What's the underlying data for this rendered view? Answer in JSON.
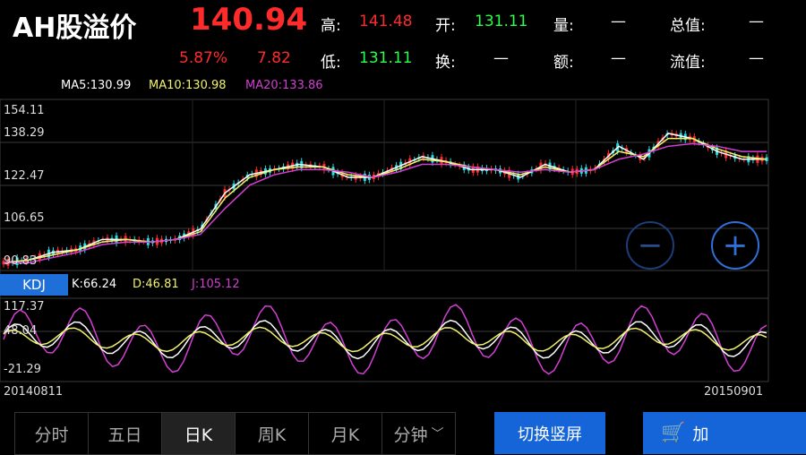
{
  "header": {
    "title": "AH股溢价",
    "price": "140.94",
    "change_pct": "5.87%",
    "change": "7.82",
    "fields": [
      {
        "label": "高:",
        "value": "141.48",
        "color": "#ff2b2b"
      },
      {
        "label": "开:",
        "value": "131.11",
        "color": "#2bff4a"
      },
      {
        "label": "量:",
        "value": "—",
        "color": "#ffffff"
      },
      {
        "label": "总值:",
        "value": "—",
        "color": "#ffffff"
      },
      {
        "label": "低:",
        "value": "131.11",
        "color": "#2bff4a"
      },
      {
        "label": "换:",
        "value": "—",
        "color": "#ffffff"
      },
      {
        "label": "额:",
        "value": "—",
        "color": "#ffffff"
      },
      {
        "label": "流值:",
        "value": "—",
        "color": "#ffffff"
      }
    ]
  },
  "ma": {
    "ma5": "MA5:130.99",
    "ma10": "MA10:130.98",
    "ma20": "MA20:133.86"
  },
  "price_axis": [
    "154.11",
    "138.29",
    "122.47",
    "106.65",
    "90.83"
  ],
  "kdj": {
    "tab": "KDJ",
    "k": "K:66.24",
    "d": "D:46.81",
    "j": "J:105.12",
    "axis": [
      "117.37",
      "48.04",
      "-21.29"
    ]
  },
  "dates": {
    "start": "20140811",
    "end": "20150901"
  },
  "periods": [
    "分时",
    "五日",
    "日K",
    "周K",
    "月K",
    "分钟"
  ],
  "selected_period": "日K",
  "buttons": {
    "rotate": "切换竖屏",
    "add": "加"
  },
  "colors": {
    "up": "#ff2b2b",
    "down": "#2bd9e0",
    "ma5": "#ffffff",
    "ma10": "#f2f26a",
    "ma20": "#d23fd2",
    "accent": "#1565d8"
  },
  "chart_data": {
    "type": "line",
    "series": [
      {
        "name": "MA5",
        "values": [
          91,
          92,
          95,
          96,
          100,
          100,
          99,
          100,
          104,
          118,
          125,
          127,
          129,
          128,
          124,
          124,
          128,
          132,
          130,
          127,
          127,
          124,
          129,
          126,
          127,
          136,
          131,
          141,
          139,
          134,
          131,
          131
        ]
      },
      {
        "name": "MA10",
        "values": [
          91,
          92,
          94,
          96,
          99,
          100,
          99,
          100,
          103,
          116,
          124,
          127,
          128,
          128,
          125,
          124,
          127,
          131,
          130,
          128,
          127,
          125,
          128,
          126,
          127,
          134,
          132,
          139,
          139,
          135,
          132,
          131
        ]
      },
      {
        "name": "MA20",
        "values": [
          91,
          91,
          93,
          95,
          98,
          99,
          99,
          100,
          102,
          112,
          121,
          125,
          127,
          127,
          126,
          124,
          126,
          129,
          129,
          128,
          127,
          126,
          127,
          126,
          127,
          131,
          133,
          136,
          137,
          136,
          134,
          134
        ]
      }
    ]
  }
}
